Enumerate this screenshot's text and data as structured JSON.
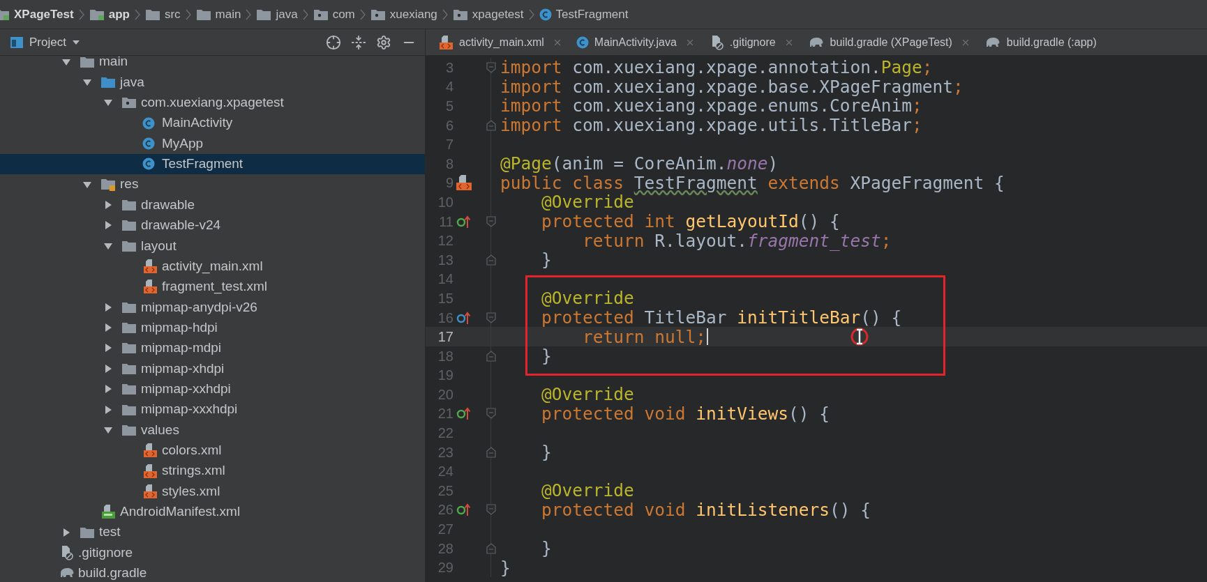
{
  "breadcrumb": [
    {
      "label": "XPageTest",
      "kind": "project",
      "bold": true
    },
    {
      "label": "app",
      "kind": "module",
      "bold": true
    },
    {
      "label": "src",
      "kind": "folder",
      "bold": false
    },
    {
      "label": "main",
      "kind": "folder",
      "bold": false
    },
    {
      "label": "java",
      "kind": "folder",
      "bold": false
    },
    {
      "label": "com",
      "kind": "package",
      "bold": false
    },
    {
      "label": "xuexiang",
      "kind": "package",
      "bold": false
    },
    {
      "label": "xpagetest",
      "kind": "package",
      "bold": false
    },
    {
      "label": "TestFragment",
      "kind": "class",
      "bold": false
    }
  ],
  "project_panel": {
    "title": "Project"
  },
  "tabs": [
    {
      "label": "activity_main.xml",
      "kind": "xml",
      "selected": false,
      "closable": true
    },
    {
      "label": "MainActivity.java",
      "kind": "class",
      "selected": false,
      "closable": true
    },
    {
      "label": ".gitignore",
      "kind": "gitignore",
      "selected": false,
      "closable": true
    },
    {
      "label": "build.gradle (XPageTest)",
      "kind": "gradle",
      "selected": false,
      "closable": true
    },
    {
      "label": "build.gradle (:app)",
      "kind": "gradle",
      "selected": false,
      "closable": false
    }
  ],
  "tree": [
    {
      "label": "main",
      "kind": "folder",
      "expanded": true,
      "selected": false,
      "children": [
        {
          "label": "java",
          "kind": "source",
          "expanded": true,
          "selected": false,
          "children": [
            {
              "label": "com.xuexiang.xpagetest",
              "kind": "package",
              "expanded": true,
              "selected": false,
              "children": [
                {
                  "label": "MainActivity",
                  "kind": "class",
                  "selected": false
                },
                {
                  "label": "MyApp",
                  "kind": "class",
                  "selected": false
                },
                {
                  "label": "TestFragment",
                  "kind": "class",
                  "selected": true
                }
              ]
            }
          ]
        },
        {
          "label": "res",
          "kind": "res",
          "expanded": true,
          "selected": false,
          "children": [
            {
              "label": "drawable",
              "kind": "folder",
              "expanded": false,
              "selected": false
            },
            {
              "label": "drawable-v24",
              "kind": "folder",
              "expanded": false,
              "selected": false
            },
            {
              "label": "layout",
              "kind": "folder",
              "expanded": true,
              "selected": false,
              "children": [
                {
                  "label": "activity_main.xml",
                  "kind": "xml",
                  "selected": false
                },
                {
                  "label": "fragment_test.xml",
                  "kind": "xml",
                  "selected": false
                }
              ]
            },
            {
              "label": "mipmap-anydpi-v26",
              "kind": "folder",
              "expanded": false,
              "selected": false
            },
            {
              "label": "mipmap-hdpi",
              "kind": "folder",
              "expanded": false,
              "selected": false
            },
            {
              "label": "mipmap-mdpi",
              "kind": "folder",
              "expanded": false,
              "selected": false
            },
            {
              "label": "mipmap-xhdpi",
              "kind": "folder",
              "expanded": false,
              "selected": false
            },
            {
              "label": "mipmap-xxhdpi",
              "kind": "folder",
              "expanded": false,
              "selected": false
            },
            {
              "label": "mipmap-xxxhdpi",
              "kind": "folder",
              "expanded": false,
              "selected": false
            },
            {
              "label": "values",
              "kind": "folder",
              "expanded": true,
              "selected": false,
              "children": [
                {
                  "label": "colors.xml",
                  "kind": "xml",
                  "selected": false
                },
                {
                  "label": "strings.xml",
                  "kind": "xml",
                  "selected": false
                },
                {
                  "label": "styles.xml",
                  "kind": "xml",
                  "selected": false
                }
              ]
            }
          ]
        },
        {
          "label": "AndroidManifest.xml",
          "kind": "manifest",
          "selected": false
        }
      ]
    },
    {
      "label": "test",
      "kind": "folder",
      "expanded": false,
      "selected": false
    }
  ],
  "project_files": [
    {
      "label": ".gitignore",
      "kind": "gitignore",
      "selected": false
    },
    {
      "label": "build.gradle",
      "kind": "gradle",
      "selected": false
    }
  ],
  "code_lines": [
    {
      "number": "3",
      "fold": {
        "kind": "start"
      },
      "tokens": [
        {
          "kind": "kw",
          "text": "import"
        },
        {
          "kind": "plain",
          "text": " com.xuexiang.xpage.annotation."
        },
        {
          "kind": "ann",
          "text": "Page"
        },
        {
          "kind": "kw",
          "text": ";"
        }
      ]
    },
    {
      "number": "4",
      "tokens": [
        {
          "kind": "kw",
          "text": "import"
        },
        {
          "kind": "plain",
          "text": " com.xuexiang.xpage.base.XPageFragment"
        },
        {
          "kind": "kw",
          "text": ";"
        }
      ]
    },
    {
      "number": "5",
      "tokens": [
        {
          "kind": "kw",
          "text": "import"
        },
        {
          "kind": "plain",
          "text": " com.xuexiang.xpage.enums.CoreAnim"
        },
        {
          "kind": "kw",
          "text": ";"
        }
      ]
    },
    {
      "number": "6",
      "fold": {
        "kind": "end"
      },
      "tokens": [
        {
          "kind": "kw",
          "text": "import"
        },
        {
          "kind": "plain",
          "text": " com.xuexiang.xpage.utils.TitleBar"
        },
        {
          "kind": "kw",
          "text": ";"
        }
      ]
    },
    {
      "number": "7"
    },
    {
      "number": "8",
      "tokens": [
        {
          "kind": "ann",
          "text": "@Page"
        },
        {
          "kind": "plain",
          "text": "(anim = CoreAnim."
        },
        {
          "kind": "field",
          "text": "none"
        },
        {
          "kind": "plain",
          "text": ")"
        }
      ]
    },
    {
      "number": "9",
      "marker": {
        "kind": "layout"
      },
      "tokens": [
        {
          "kind": "kw",
          "text": "public class "
        },
        {
          "kind": "warn",
          "text": "TestFragment"
        },
        {
          "kind": "kw",
          "text": " extends "
        },
        {
          "kind": "plain",
          "text": "XPageFragment {"
        }
      ]
    },
    {
      "number": "10",
      "tokens": [
        {
          "kind": "ann",
          "text": "    @Override"
        }
      ]
    },
    {
      "number": "11",
      "marker": {
        "kind": "override"
      },
      "fold": {
        "kind": "start"
      },
      "tokens": [
        {
          "kind": "kw",
          "text": "    protected int "
        },
        {
          "kind": "fn",
          "text": "getLayoutId"
        },
        {
          "kind": "plain",
          "text": "() {"
        }
      ]
    },
    {
      "number": "12",
      "tokens": [
        {
          "kind": "kw",
          "text": "        return "
        },
        {
          "kind": "plain",
          "text": "R.layout."
        },
        {
          "kind": "field",
          "text": "fragment_test"
        },
        {
          "kind": "kw",
          "text": ";"
        }
      ]
    },
    {
      "number": "13",
      "fold": {
        "kind": "end"
      },
      "tokens": [
        {
          "kind": "plain",
          "text": "    }"
        }
      ]
    },
    {
      "number": "14",
      "boxed": true
    },
    {
      "number": "15",
      "boxed": true,
      "tokens": [
        {
          "kind": "ann",
          "text": "    @Override"
        }
      ]
    },
    {
      "number": "16",
      "boxed": true,
      "marker": {
        "kind": "implement"
      },
      "fold": {
        "kind": "start"
      },
      "tokens": [
        {
          "kind": "kw",
          "text": "    protected "
        },
        {
          "kind": "plain",
          "text": "TitleBar "
        },
        {
          "kind": "fn",
          "text": "initTitleBar"
        },
        {
          "kind": "plain",
          "text": "() {"
        }
      ]
    },
    {
      "number": "17",
      "boxed": true,
      "current": true,
      "tokens": [
        {
          "kind": "kw",
          "text": "        return null;"
        }
      ]
    },
    {
      "number": "18",
      "boxed": true,
      "fold": {
        "kind": "end"
      },
      "tokens": [
        {
          "kind": "plain",
          "text": "    }"
        }
      ]
    },
    {
      "number": "19"
    },
    {
      "number": "20",
      "tokens": [
        {
          "kind": "ann",
          "text": "    @Override"
        }
      ]
    },
    {
      "number": "21",
      "marker": {
        "kind": "override"
      },
      "fold": {
        "kind": "start"
      },
      "tokens": [
        {
          "kind": "kw",
          "text": "    protected void "
        },
        {
          "kind": "fn",
          "text": "initViews"
        },
        {
          "kind": "plain",
          "text": "() {"
        }
      ]
    },
    {
      "number": "22"
    },
    {
      "number": "23",
      "fold": {
        "kind": "end"
      },
      "tokens": [
        {
          "kind": "plain",
          "text": "    }"
        }
      ]
    },
    {
      "number": "24"
    },
    {
      "number": "25",
      "tokens": [
        {
          "kind": "ann",
          "text": "    @Override"
        }
      ]
    },
    {
      "number": "26",
      "marker": {
        "kind": "override"
      },
      "fold": {
        "kind": "start"
      },
      "tokens": [
        {
          "kind": "kw",
          "text": "    protected void "
        },
        {
          "kind": "fn",
          "text": "initListeners"
        },
        {
          "kind": "plain",
          "text": "() {"
        }
      ]
    },
    {
      "number": "27"
    },
    {
      "number": "28",
      "fold": {
        "kind": "end"
      },
      "tokens": [
        {
          "kind": "plain",
          "text": "    }"
        }
      ]
    },
    {
      "number": "29",
      "tokens": [
        {
          "kind": "plain",
          "text": "}"
        }
      ]
    }
  ]
}
